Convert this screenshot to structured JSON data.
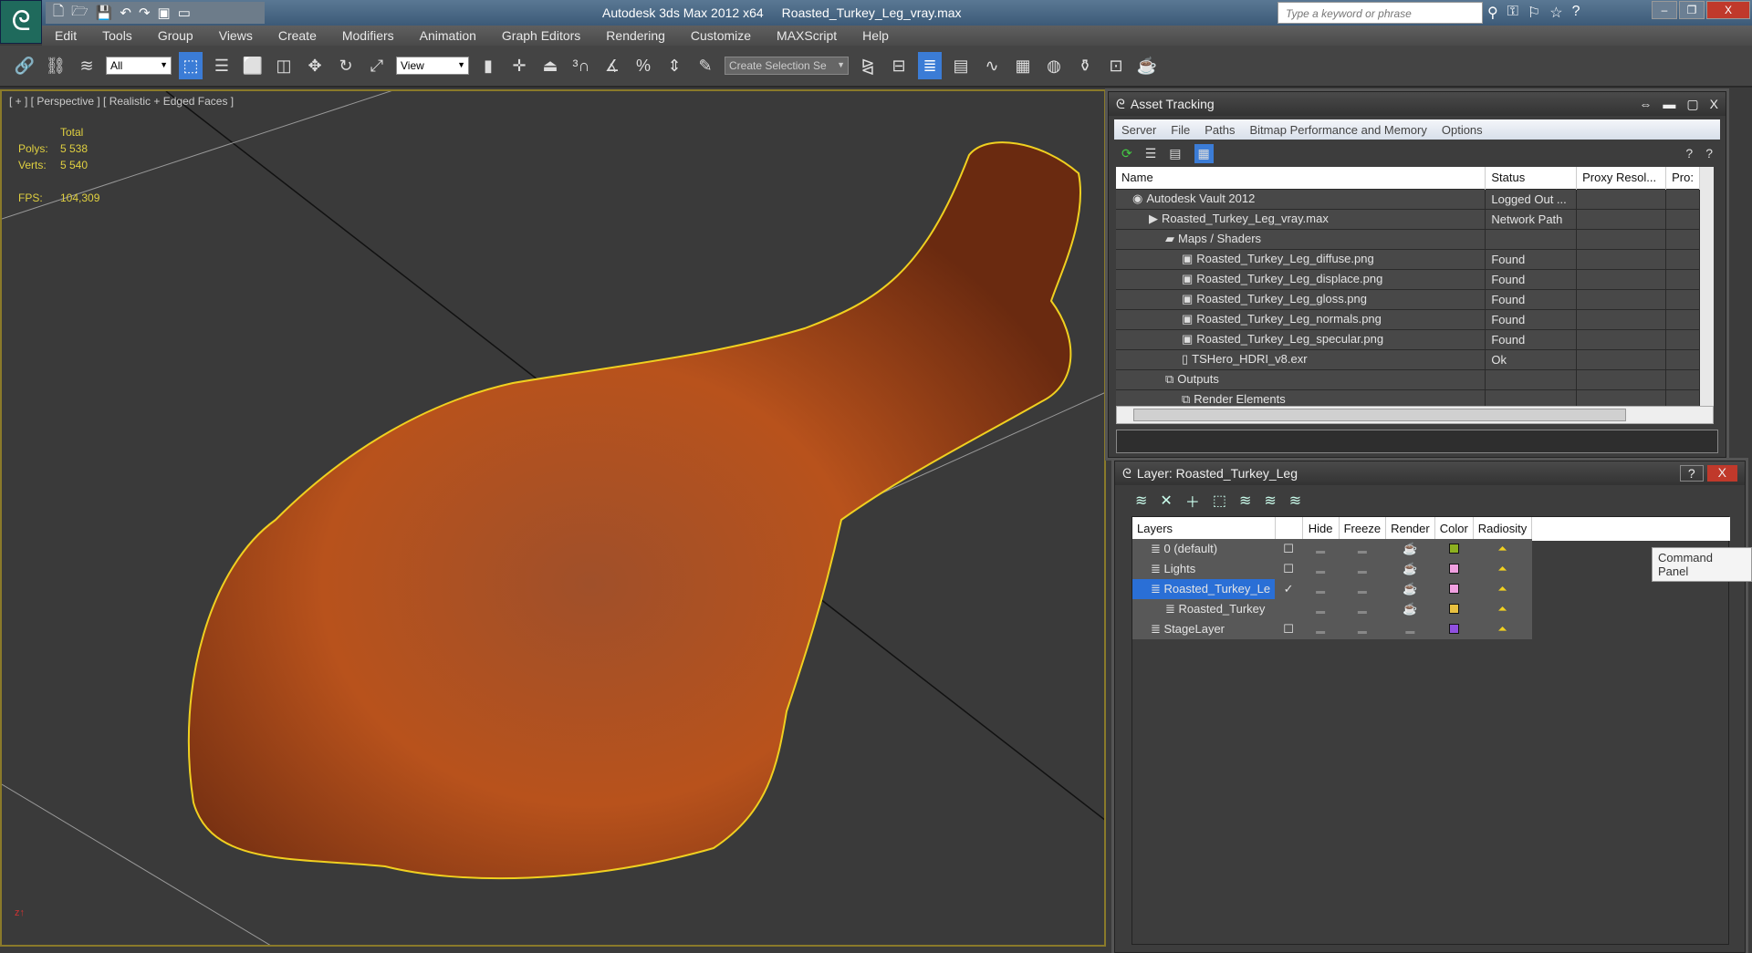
{
  "app": {
    "title": "Autodesk 3ds Max  2012 x64",
    "file": "Roasted_Turkey_Leg_vray.max",
    "search_placeholder": "Type a keyword or phrase"
  },
  "menu": [
    "Edit",
    "Tools",
    "Group",
    "Views",
    "Create",
    "Modifiers",
    "Animation",
    "Graph Editors",
    "Rendering",
    "Customize",
    "MAXScript",
    "Help"
  ],
  "toolbar": {
    "filter": "All",
    "coord": "View",
    "selection_set": "Create Selection Se"
  },
  "viewport": {
    "label": "[ + ] [ Perspective ] [ Realistic + Edged Faces ]",
    "total": "Total",
    "polys_label": "Polys:",
    "polys": "5 538",
    "verts_label": "Verts:",
    "verts": "5 540",
    "fps_label": "FPS:",
    "fps": "104,309"
  },
  "asset": {
    "title": "Asset Tracking",
    "menu": [
      "Server",
      "File",
      "Paths",
      "Bitmap Performance and Memory",
      "Options"
    ],
    "columns": [
      "Name",
      "Status",
      "Proxy Resol...",
      "Pro:"
    ],
    "rows": [
      {
        "name": "Autodesk Vault 2012",
        "status": "Logged Out ...",
        "indent": 1
      },
      {
        "name": "Roasted_Turkey_Leg_vray.max",
        "status": "Network Path",
        "indent": 2
      },
      {
        "name": "Maps / Shaders",
        "status": "",
        "indent": 3
      },
      {
        "name": "Roasted_Turkey_Leg_diffuse.png",
        "status": "Found",
        "indent": 4
      },
      {
        "name": "Roasted_Turkey_Leg_displace.png",
        "status": "Found",
        "indent": 4
      },
      {
        "name": "Roasted_Turkey_Leg_gloss.png",
        "status": "Found",
        "indent": 4
      },
      {
        "name": "Roasted_Turkey_Leg_normals.png",
        "status": "Found",
        "indent": 4
      },
      {
        "name": "Roasted_Turkey_Leg_specular.png",
        "status": "Found",
        "indent": 4
      },
      {
        "name": "TSHero_HDRI_v8.exr",
        "status": "Ok",
        "indent": 4
      },
      {
        "name": "Outputs",
        "status": "",
        "indent": 3
      },
      {
        "name": "Render Elements",
        "status": "",
        "indent": 4
      }
    ]
  },
  "layer": {
    "title": "Layer: Roasted_Turkey_Leg",
    "columns": [
      "Layers",
      "",
      "Hide",
      "Freeze",
      "Render",
      "Color",
      "Radiosity"
    ],
    "rows": [
      {
        "name": "0 (default)",
        "color": "#8cb020",
        "active": "☐"
      },
      {
        "name": "Lights",
        "color": "#f0a0e0",
        "active": "☐"
      },
      {
        "name": "Roasted_Turkey_Le",
        "color": "#f0a0e0",
        "active": "✓",
        "selected": true
      },
      {
        "name": "Roasted_Turkey",
        "color": "#e8c040",
        "active": ""
      },
      {
        "name": "StageLayer",
        "color": "#9050e0",
        "active": "☐"
      }
    ]
  },
  "tooltip": "Command Panel"
}
